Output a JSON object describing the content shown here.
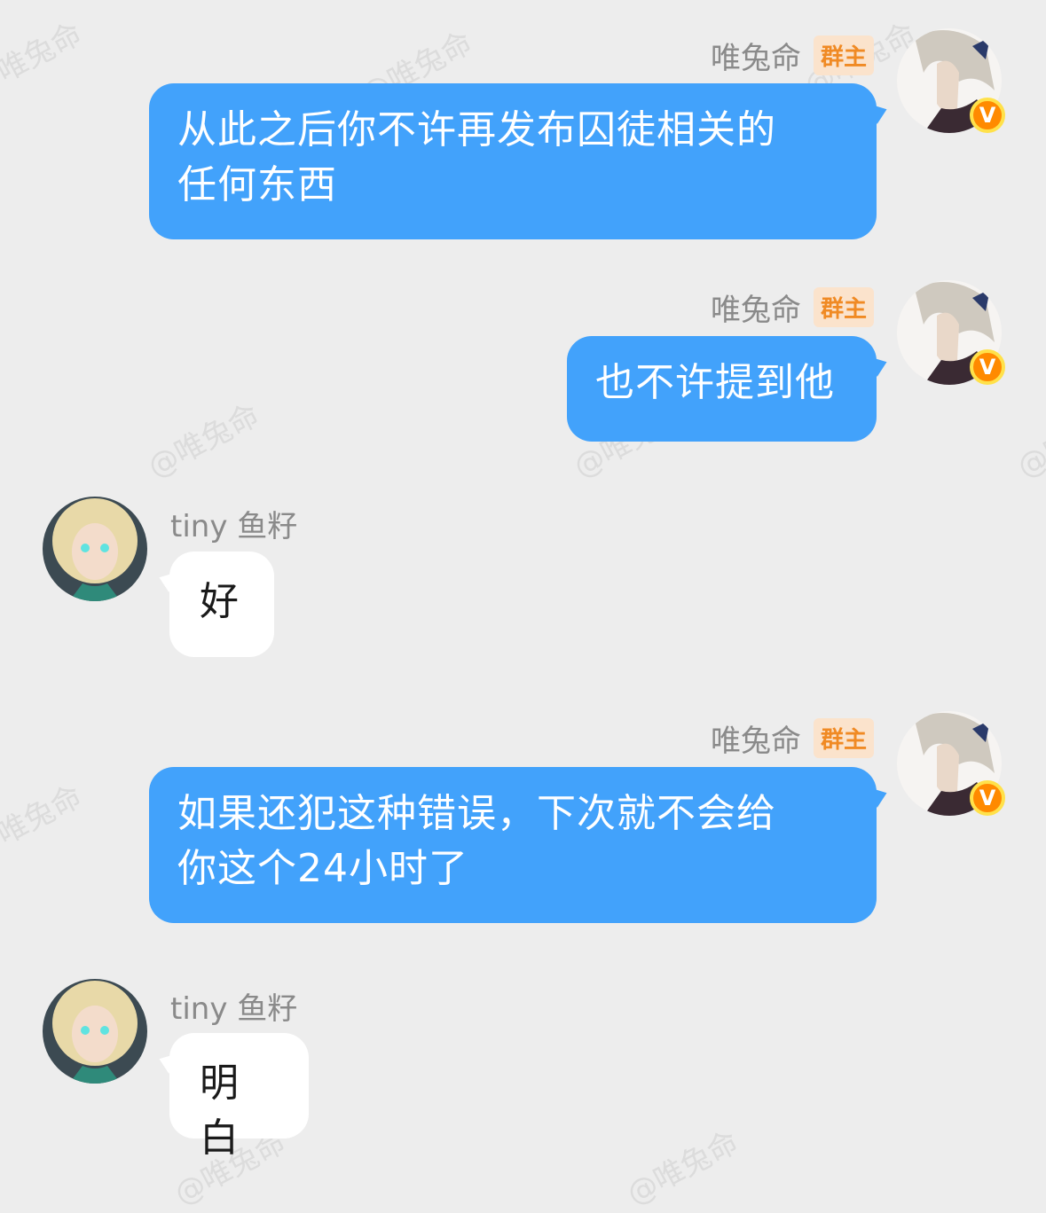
{
  "watermark": "@唯兔命",
  "messages": [
    {
      "sender": "唯兔命",
      "role": "群主",
      "direction": "out",
      "lines": [
        "从此之后你不许再发布囚徒相关的",
        "任何东西"
      ],
      "avatar": "avatar-owner",
      "verified": "v-badge-icon"
    },
    {
      "sender": "唯兔命",
      "role": "群主",
      "direction": "out",
      "lines": [
        "也不许提到他"
      ],
      "avatar": "avatar-owner",
      "verified": "v-badge-icon"
    },
    {
      "sender": "tiny 鱼籽",
      "direction": "in",
      "lines": [
        "好"
      ],
      "avatar": "avatar-member"
    },
    {
      "sender": "唯兔命",
      "role": "群主",
      "direction": "out",
      "lines": [
        "如果还犯这种错误，下次就不会给",
        "你这个24小时了"
      ],
      "avatar": "avatar-owner",
      "verified": "v-badge-icon"
    },
    {
      "sender": "tiny 鱼籽",
      "direction": "in",
      "lines": [
        "明白"
      ],
      "avatar": "avatar-member"
    }
  ],
  "badge_letter": "V",
  "colors": {
    "outgoing": "#42a2fb",
    "incoming": "#ffffff",
    "background": "#ededed",
    "role_badge": "#f08a24"
  }
}
